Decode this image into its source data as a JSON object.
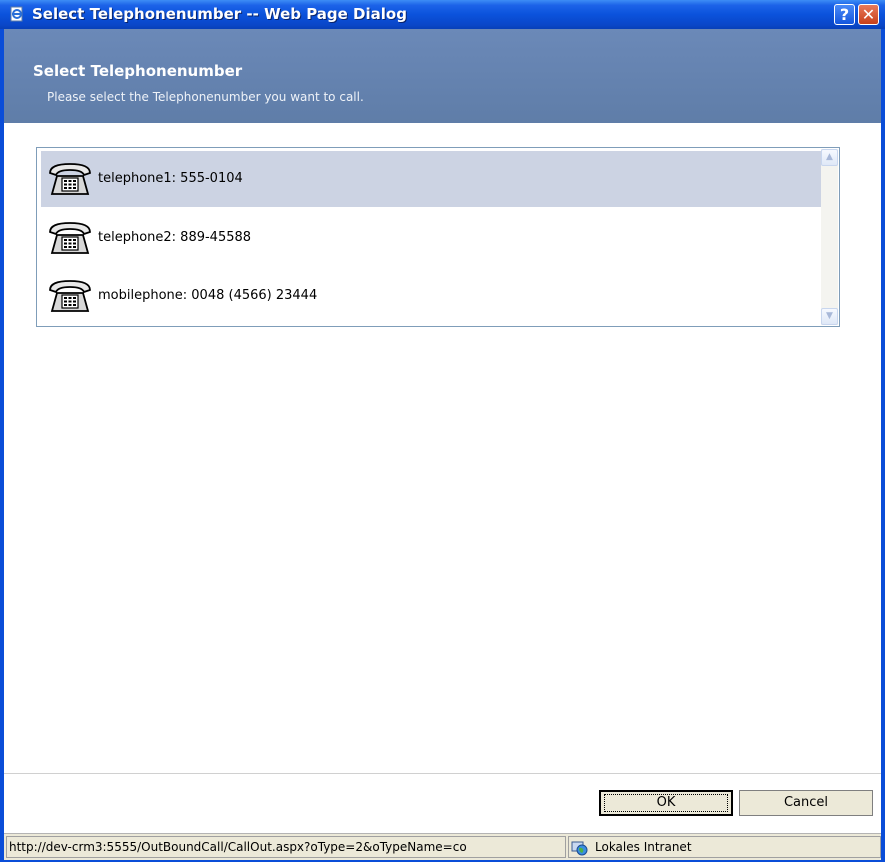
{
  "window": {
    "title": "Select Telephonenumber -- Web Page Dialog",
    "help_label": "?",
    "close_label": "✕"
  },
  "header": {
    "title": "Select Telephonenumber",
    "subtitle": "Please select the Telephonenumber you want to call."
  },
  "list": {
    "items": [
      {
        "label": "telephone1: 555-0104",
        "selected": true
      },
      {
        "label": "telephone2: 889-45588",
        "selected": false
      },
      {
        "label": "mobilephone: 0048 (4566) 23444",
        "selected": false
      }
    ],
    "icon": "telephone-icon"
  },
  "buttons": {
    "ok_label": "OK",
    "cancel_label": "Cancel"
  },
  "status": {
    "url": "http://dev-crm3:5555/OutBoundCall/CallOut.aspx?oType=2&oTypeName=co",
    "zone": "Lokales Intranet"
  },
  "colors": {
    "titlebar": "#0a4dd8",
    "header": "#6b89b8",
    "selection": "#ccd3e3"
  }
}
